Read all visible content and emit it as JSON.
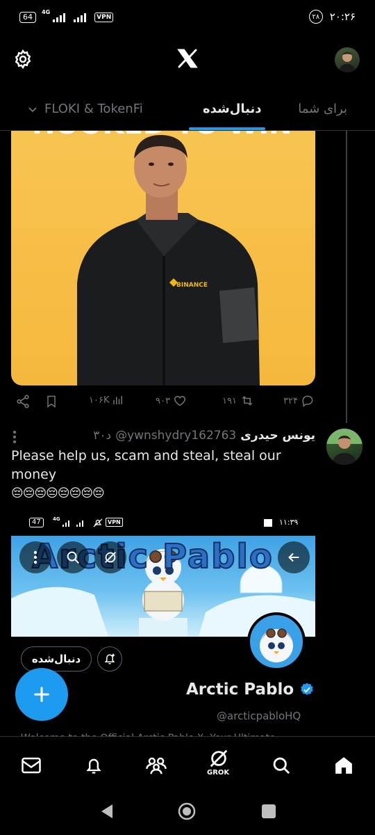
{
  "status_bar": {
    "battery": "64",
    "network": "4G",
    "vpn": "VPN",
    "notification_count": "۲۸",
    "time": "۲۰:۲۶"
  },
  "header": {
    "logo": "X"
  },
  "tabs": [
    {
      "label": "برای شما",
      "active": false
    },
    {
      "label": "دنبال‌شده",
      "active": true
    },
    {
      "label": "FLOKI & TokenFi",
      "active": false
    }
  ],
  "tweet1": {
    "image_brand": "BINANCE",
    "actions": {
      "replies": "۳۲۴",
      "reposts": "۱۹۱",
      "likes": "۹۰۳",
      "views": "۱۰۶K"
    }
  },
  "tweet2": {
    "name": "یونس حیدری",
    "handle": "@ywnshydry162763",
    "time": "۳۰د",
    "text": "Please help us, scam and steal, steal our money",
    "emojis": "😔😔😔😔😔😔😔😔"
  },
  "embedded": {
    "battery": "47",
    "network": "4G",
    "vpn": "VPN",
    "time": "۱۱:۳۹",
    "banner_title": "Arctic Pablo",
    "follow_label": "دنبال‌شده",
    "profile_name": "Arctic Pablo",
    "profile_handle": "@arcticpabloHQ",
    "bio_peek": "Welcome to the Official Arctic Pablo X. Your Ultimate"
  },
  "bottom_nav": {
    "grok_label": "GROK"
  },
  "colors": {
    "accent": "#1d9bf0",
    "background": "#000000",
    "text_secondary": "#71767b"
  }
}
